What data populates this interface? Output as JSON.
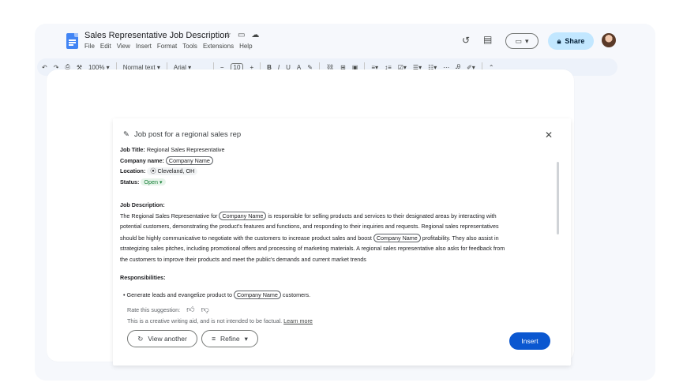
{
  "app": {
    "title": "Sales Representative Job Description",
    "menu": [
      "File",
      "Edit",
      "View",
      "Insert",
      "Format",
      "Tools",
      "Extensions",
      "Help"
    ],
    "share_label": "Share"
  },
  "toolbar": {
    "zoom": "100%",
    "style": "Normal text",
    "font": "Arial",
    "font_size": "10"
  },
  "panel": {
    "title": "Job post for a regional sales rep",
    "job_title_label": "Job Title:",
    "job_title_value": "Regional Sales Representative",
    "company_label": "Company name:",
    "company_placeholder": "Company Name",
    "location_label": "Location:",
    "location_value": "Cleveland, OH",
    "status_label": "Status:",
    "status_value": "Open",
    "desc_heading": "Job Description:",
    "desc_1a": "The Regional Sales Representative for",
    "desc_1b": "is responsible for selling products and services to their designated areas by interacting with",
    "desc_2": "potential customers, demonstrating the product's features and functions, and responding to their inquiries and requests. Regional sales representatives",
    "desc_3a": "should be highly communicative to negotiate with the customers to increase product sales and boost",
    "desc_3b": "profitability. They also assist in",
    "desc_4": "strategizing sales pitches, including promotional offers and processing of marketing materials. A regional sales representative also asks for feedback from",
    "desc_5": "the customers to improve their products and meet the public's demands and current market trends",
    "resp_heading": "Responsibilities:",
    "resp_1a": "Generate leads and evangelize product to",
    "resp_1b": "customers.",
    "rate_label": "Rate this suggestion:",
    "disclaimer": "This is a creative writing aid, and is not intended to be factual.",
    "learn_more": "Learn more",
    "view_another": "View another",
    "refine": "Refine",
    "insert": "Insert"
  },
  "icons": [
    "docs-logo-icon",
    "star-icon",
    "folder-icon",
    "cloud-icon",
    "history-icon",
    "comment-icon",
    "video-icon",
    "lock-icon",
    "pen-spark-icon",
    "close-icon",
    "thumb-up-icon",
    "thumb-down-icon",
    "refresh-icon",
    "filter-icon"
  ],
  "colors": {
    "accent": "#0b57d0",
    "share_bg": "#c2e7ff",
    "status_green": "#188038"
  }
}
